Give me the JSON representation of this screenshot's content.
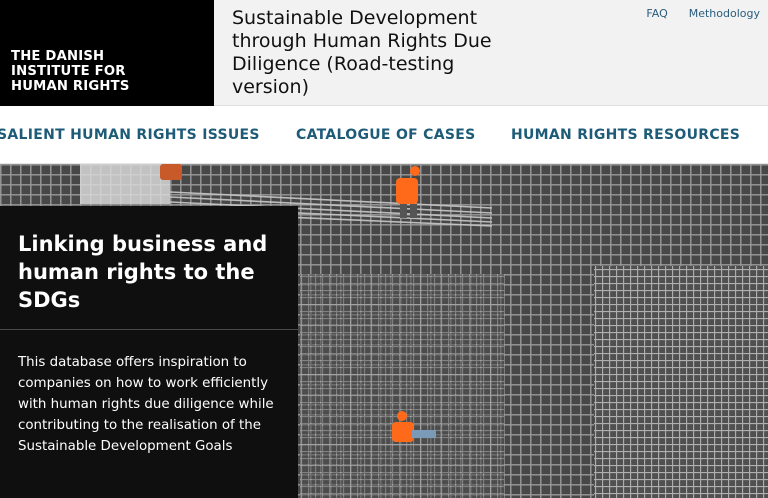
{
  "header": {
    "logo_text": "THE DANISH\nINSTITUTE FOR\nHUMAN RIGHTS",
    "site_title": "Sustainable Development through Human Rights Due Diligence (Road-testing version)",
    "links": {
      "faq": "FAQ",
      "methodology": "Methodology"
    }
  },
  "nav": {
    "items": [
      {
        "label": "SALIENT HUMAN RIGHTS ISSUES"
      },
      {
        "label": "CATALOGUE OF CASES"
      },
      {
        "label": "HUMAN RIGHTS RESOURCES"
      }
    ]
  },
  "hero": {
    "title": "Linking business and human rights to the SDGs",
    "description": "This database offers inspiration to companies on how to work efficiently with human rights due diligence while contributing to the realisation of the Sustainable Development Goals",
    "image": "construction-workers-on-rebar-grid",
    "colors": {
      "panel": "#0f0f0f",
      "accent": "#1d5b78",
      "vest": "#ff6a1a"
    }
  }
}
